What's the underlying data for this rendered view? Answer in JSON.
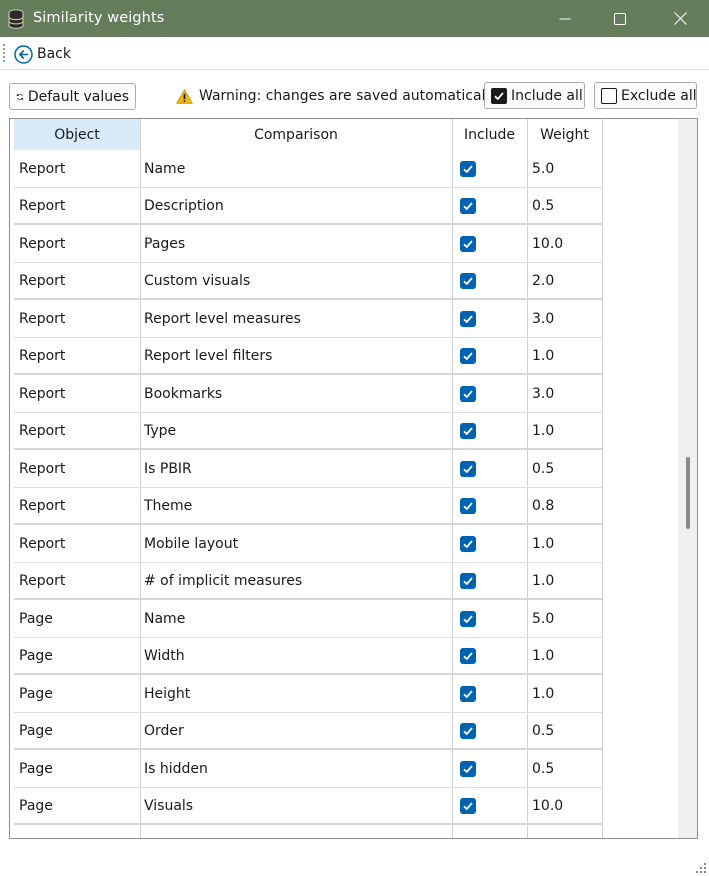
{
  "window": {
    "title": "Similarity weights",
    "app_icon": "database-icon",
    "controls": [
      "minimize-icon",
      "maximize-icon",
      "close-icon"
    ],
    "titlebar_color": "#667d5c"
  },
  "nav": {
    "back_label": "Back",
    "back_icon": "arrow-left-circle-icon",
    "accent": "#0063b1"
  },
  "toolbar": {
    "default_label": "Default values",
    "default_icon": "refresh-icon",
    "warning_icon": "warning-triangle-icon",
    "warning_text": "Warning: changes are saved automatically",
    "include_all_label": "Include all",
    "include_all_checked": true,
    "exclude_all_label": "Exclude all",
    "exclude_all_checked": false
  },
  "grid": {
    "columns": [
      "Object",
      "Comparison",
      "Include",
      "Weight"
    ],
    "sorted_column": "Object",
    "rows": [
      {
        "object": "Report",
        "comparison": "Name",
        "include": true,
        "weight": "5.0"
      },
      {
        "object": "Report",
        "comparison": "Description",
        "include": true,
        "weight": "0.5"
      },
      {
        "object": "Report",
        "comparison": "Pages",
        "include": true,
        "weight": "10.0"
      },
      {
        "object": "Report",
        "comparison": "Custom visuals",
        "include": true,
        "weight": "2.0"
      },
      {
        "object": "Report",
        "comparison": "Report level measures",
        "include": true,
        "weight": "3.0"
      },
      {
        "object": "Report",
        "comparison": "Report level filters",
        "include": true,
        "weight": "1.0"
      },
      {
        "object": "Report",
        "comparison": "Bookmarks",
        "include": true,
        "weight": "3.0"
      },
      {
        "object": "Report",
        "comparison": "Type",
        "include": true,
        "weight": "1.0"
      },
      {
        "object": "Report",
        "comparison": "Is PBIR",
        "include": true,
        "weight": "0.5"
      },
      {
        "object": "Report",
        "comparison": "Theme",
        "include": true,
        "weight": "0.8"
      },
      {
        "object": "Report",
        "comparison": "Mobile layout",
        "include": true,
        "weight": "1.0"
      },
      {
        "object": "Report",
        "comparison": "# of implicit measures",
        "include": true,
        "weight": "1.0"
      },
      {
        "object": "Page",
        "comparison": "Name",
        "include": true,
        "weight": "5.0"
      },
      {
        "object": "Page",
        "comparison": "Width",
        "include": true,
        "weight": "1.0"
      },
      {
        "object": "Page",
        "comparison": "Height",
        "include": true,
        "weight": "1.0"
      },
      {
        "object": "Page",
        "comparison": "Order",
        "include": true,
        "weight": "0.5"
      },
      {
        "object": "Page",
        "comparison": "Is hidden",
        "include": true,
        "weight": "0.5"
      },
      {
        "object": "Page",
        "comparison": "Visuals",
        "include": true,
        "weight": "10.0"
      }
    ],
    "scroll_position_fraction": 0.47,
    "scroll_visible_fraction": 0.1
  }
}
